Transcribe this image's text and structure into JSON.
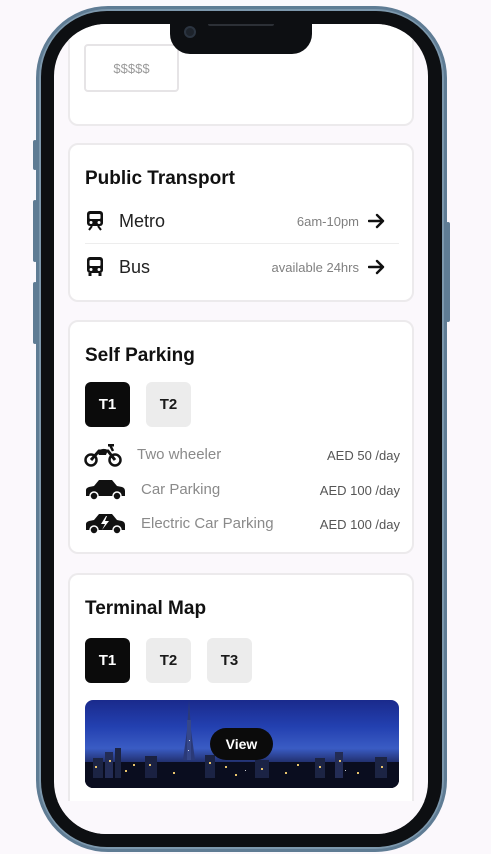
{
  "top_card": {
    "price_value": "$$$$$"
  },
  "public_transport": {
    "title": "Public Transport",
    "items": [
      {
        "icon": "metro-icon",
        "label": "Metro",
        "info": "6am-10pm"
      },
      {
        "icon": "bus-icon",
        "label": "Bus",
        "info": "available 24hrs"
      }
    ]
  },
  "self_parking": {
    "title": "Self Parking",
    "terminals": [
      {
        "label": "T1",
        "active": true
      },
      {
        "label": "T2",
        "active": false
      }
    ],
    "items": [
      {
        "icon": "motorcycle-icon",
        "label": "Two wheeler",
        "price": "AED 50 /day"
      },
      {
        "icon": "car-icon",
        "label": "Car Parking",
        "price": "AED 100 /day"
      },
      {
        "icon": "electric-car-icon",
        "label": "Electric Car Parking",
        "price": "AED 100 /day"
      }
    ]
  },
  "terminal_map": {
    "title": "Terminal Map",
    "terminals": [
      {
        "label": "T1",
        "active": true
      },
      {
        "label": "T2",
        "active": false
      },
      {
        "label": "T3",
        "active": false
      }
    ],
    "view_label": "View"
  }
}
